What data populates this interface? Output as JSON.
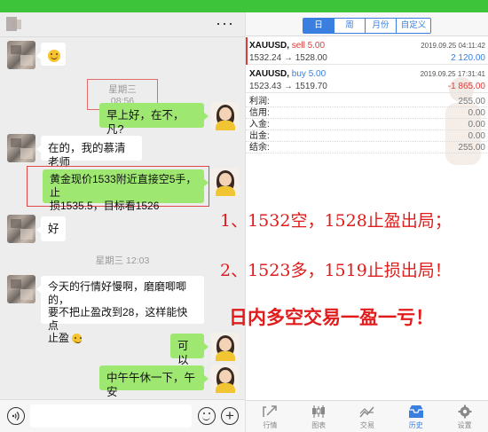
{
  "chat": {
    "header": {
      "more_label": "···"
    },
    "messages": {
      "m1_emoji": "smile",
      "ts1": "星期三 08:56",
      "m2": "早上好，在不，凡?",
      "m3": "在的，我的慕清老师",
      "m4_line1": "黄金现价1533附近直接空5手，止",
      "m4_line2": "损1535.5，目标看1526",
      "m5": "好",
      "ts2": "星期三 12:03",
      "m6_line1": "今天的行情好慢啊，磨磨唧唧的，",
      "m6_line2": "要不把止盈改到28，这样能快点",
      "m6_line3": "止盈",
      "m7": "可以",
      "m8": "中午午休一下，午安"
    },
    "input": {
      "placeholder": ""
    }
  },
  "trade": {
    "period_tabs": [
      "日",
      "周",
      "月份",
      "自定义"
    ],
    "active_tab": "日",
    "deals": [
      {
        "symbol": "XAUUSD,",
        "side": "sell 5.00",
        "prices": "1532.24 → 1528.00",
        "time": "2019.09.25 04:11:42",
        "pnl": "2 120.00"
      },
      {
        "symbol": "XAUUSD,",
        "side": "buy 5.00",
        "prices": "1523.43 → 1519.70",
        "time": "2019.09.25 17:31:41",
        "pnl": "-1 865.00"
      }
    ],
    "summary": [
      {
        "label": "利润:",
        "value": "255.00"
      },
      {
        "label": "信用:",
        "value": "0.00"
      },
      {
        "label": "入金:",
        "value": "0.00"
      },
      {
        "label": "出金:",
        "value": "0.00"
      },
      {
        "label": "结余:",
        "value": "255.00"
      }
    ],
    "nav": [
      {
        "label": "行情",
        "icon": "quotes-icon"
      },
      {
        "label": "图表",
        "icon": "chart-icon"
      },
      {
        "label": "交易",
        "icon": "trade-icon"
      },
      {
        "label": "历史",
        "icon": "history-icon"
      },
      {
        "label": "设置",
        "icon": "settings-icon"
      }
    ],
    "active_nav": "历史"
  },
  "overlay": {
    "line1": "1、1532空，1528止盈出局；",
    "line2": "2、1523多，1519止损出局！",
    "line3": "日内多空交易一盈一亏！"
  },
  "colors": {
    "frame_green": "#3ec43a",
    "bubble_green": "#9ee871",
    "accent_blue": "#3a7fe0",
    "loss_red": "#e03a3a",
    "overlay_red": "#e01c1c"
  }
}
